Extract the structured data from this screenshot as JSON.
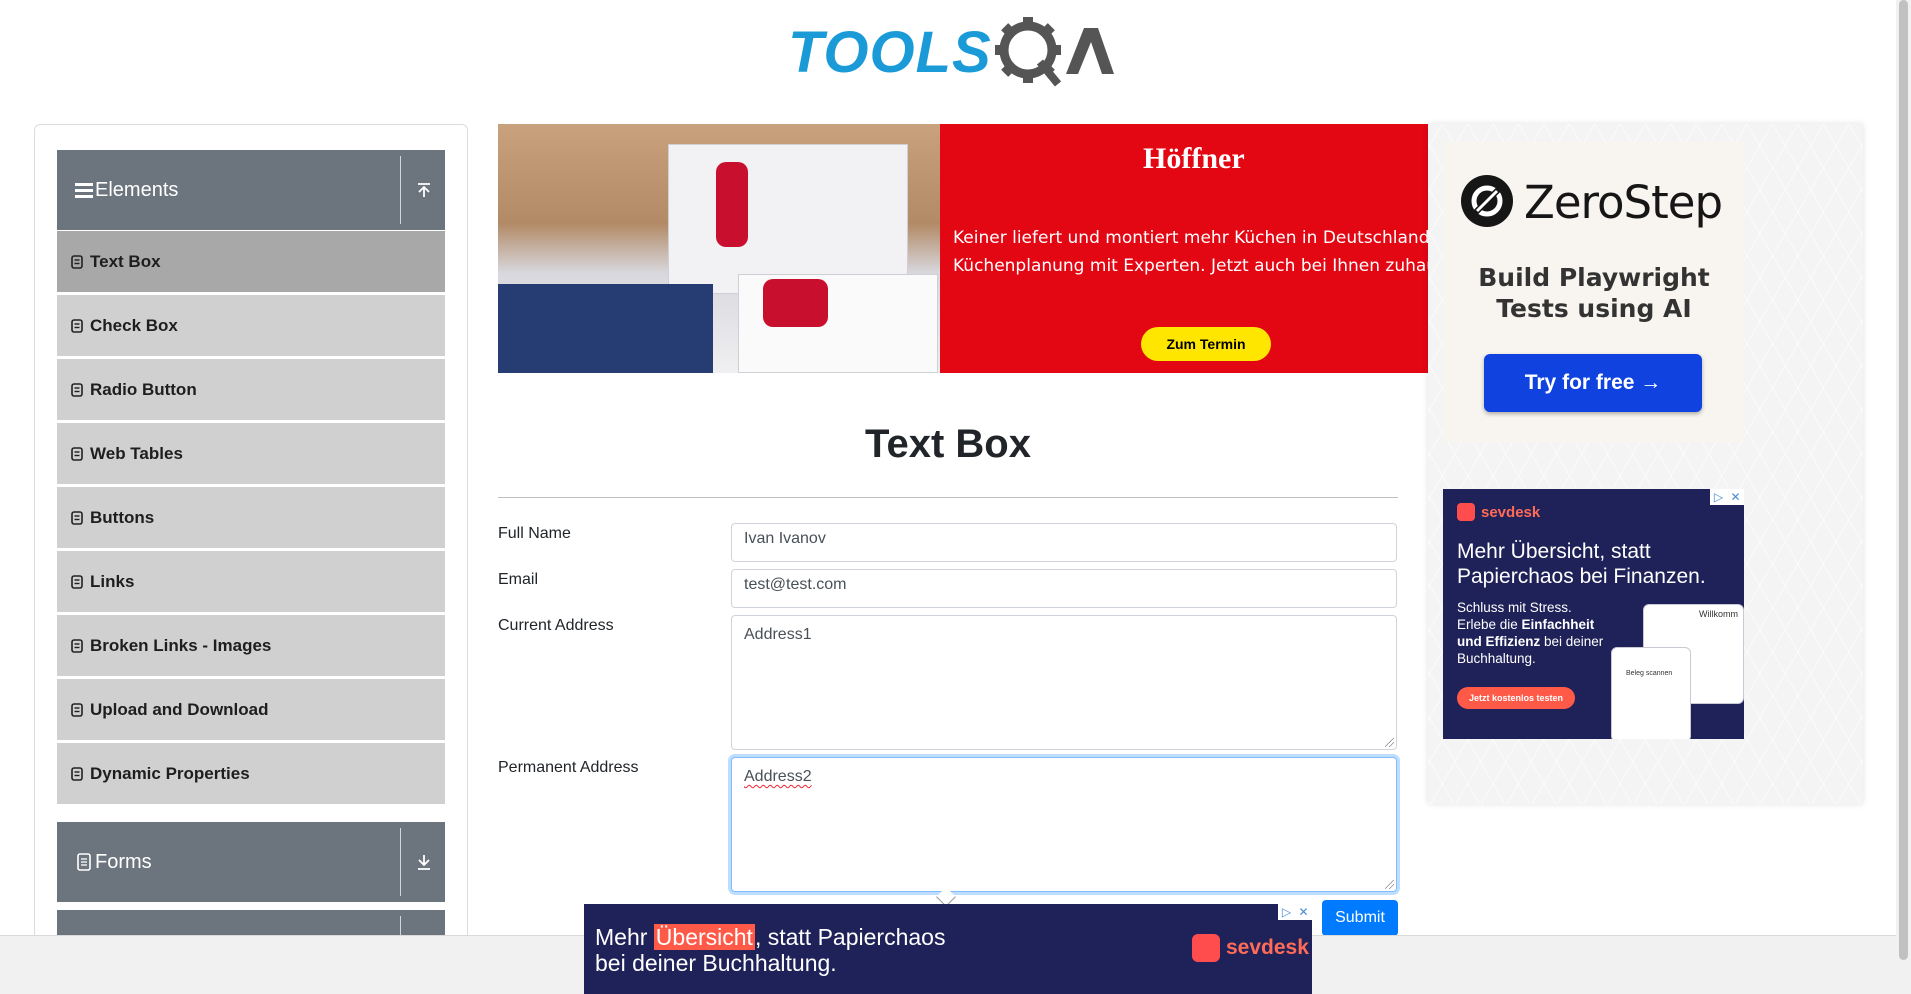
{
  "header": {
    "logo_tools": "TOOLS",
    "logo_qa": "QA",
    "logo_name": "ToolsQA"
  },
  "sidebar": {
    "groups": [
      {
        "label": "Elements",
        "icon": "list-icon",
        "expanded": true
      },
      {
        "label": "Forms",
        "icon": "form-icon",
        "expanded": false
      }
    ],
    "items": [
      {
        "label": "Text Box",
        "active": true
      },
      {
        "label": "Check Box"
      },
      {
        "label": "Radio Button"
      },
      {
        "label": "Web Tables"
      },
      {
        "label": "Buttons"
      },
      {
        "label": "Links"
      },
      {
        "label": "Broken Links - Images"
      },
      {
        "label": "Upload and Download"
      },
      {
        "label": "Dynamic Properties"
      }
    ]
  },
  "banner_ad": {
    "brand": "Höffner",
    "copy_line1": "Keiner liefert und montiert mehr Küchen in Deutschland",
    "copy_line2": "Küchenplanung mit Experten. Jetzt auch bei Ihnen zuhau",
    "cta": "Zum Termin",
    "accent": "#e30613"
  },
  "right_ads": {
    "zerostep": {
      "name": "ZeroStep",
      "tagline_line1": "Build Playwright",
      "tagline_line2": "Tests using AI",
      "cta": "Try for free →",
      "accent": "#1042e0"
    },
    "sevdesk": {
      "brand": "sevdesk",
      "headline_line1": "Mehr Übersicht, statt",
      "headline_line2": "Papierchaos bei Finanzen.",
      "body_line1": "Schluss mit Stress.",
      "body_line2_pre": "Erlebe die ",
      "body_line2_bold": "Einfachheit",
      "body_line3_bold": "und Effizienz",
      "body_line3_post": " bei deiner",
      "body_line4": "Buchhaltung.",
      "cta": "Jetzt kostenlos testen",
      "phone_text": "Willkomm",
      "phone_title": "Beleg scannen"
    }
  },
  "form": {
    "title": "Text Box",
    "full_name_label": "Full Name",
    "full_name_value": "Ivan Ivanov",
    "email_label": "Email",
    "email_value": "test@test.com",
    "current_address_label": "Current Address",
    "current_address_value": "Address1",
    "permanent_address_label": "Permanent Address",
    "permanent_address_value": "Address2",
    "submit_label": "Submit"
  },
  "bottom_ad": {
    "text_pre": "Mehr ",
    "text_highlight": "Übersicht",
    "text_post": ", statt Papierchaos",
    "text_line2": "bei deiner Buchhaltung.",
    "brand": "sevdesk"
  },
  "ad_chip": {
    "info": "▷",
    "close": "✕"
  }
}
